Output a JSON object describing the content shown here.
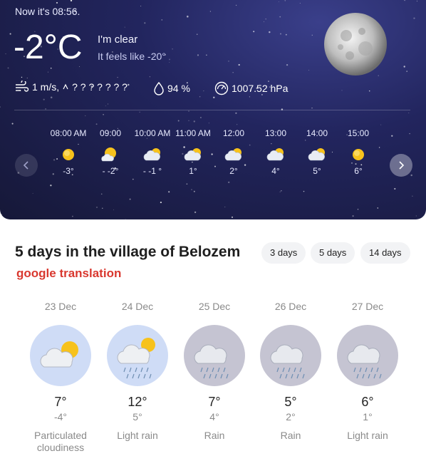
{
  "current": {
    "now_text": "Now it's 08:56.",
    "temperature": "-2°C",
    "condition": "I'm clear",
    "feels_like": "It feels like -20°",
    "moon_icon": "full-moon-icon"
  },
  "stats": {
    "wind": "1 m/s,",
    "wind_direction": "? ? ? ? ? ? ?",
    "humidity": "94 %",
    "pressure": "1007.52 hPa"
  },
  "hourly": [
    {
      "time": "08:00 AM",
      "temp": "-3°",
      "icon": "sun-icon"
    },
    {
      "time": "09:00",
      "temp": "- -2°",
      "icon": "sun-cloud-icon"
    },
    {
      "time": "10:00 AM",
      "temp": "- -1 °",
      "icon": "cloud-sun-icon"
    },
    {
      "time": "11:00 AM",
      "temp": "1°",
      "icon": "cloud-sun-icon"
    },
    {
      "time": "12:00",
      "temp": "2°",
      "icon": "cloud-sun-icon"
    },
    {
      "time": "13:00",
      "temp": "4°",
      "icon": "cloud-sun-icon"
    },
    {
      "time": "14:00",
      "temp": "5°",
      "icon": "cloud-sun-icon"
    },
    {
      "time": "15:00",
      "temp": "6°",
      "icon": "sun-icon"
    }
  ],
  "forecast": {
    "title": "5 days in the village of Belozem",
    "subtitle": "google translation",
    "ranges": [
      "3 days",
      "5 days",
      "14 days"
    ],
    "days": [
      {
        "date": "23 Dec",
        "high": "7°",
        "low": "-4°",
        "desc": "Particulated cloudiness",
        "icon": "cloud-sun-icon"
      },
      {
        "date": "24 Dec",
        "high": "12°",
        "low": "5°",
        "desc": "Light rain",
        "icon": "sun-cloud-rain-icon"
      },
      {
        "date": "25 Dec",
        "high": "7°",
        "low": "4°",
        "desc": "Rain",
        "icon": "rain-cloud-icon"
      },
      {
        "date": "26 Dec",
        "high": "5°",
        "low": "2°",
        "desc": "Rain",
        "icon": "rain-cloud-icon"
      },
      {
        "date": "27 Dec",
        "high": "6°",
        "low": "1°",
        "desc": "Light rain",
        "icon": "rain-cloud-icon"
      }
    ]
  },
  "colors": {
    "night_sky": "#22255e",
    "accent_red": "#d9382f",
    "sun": "#f7c21c"
  }
}
